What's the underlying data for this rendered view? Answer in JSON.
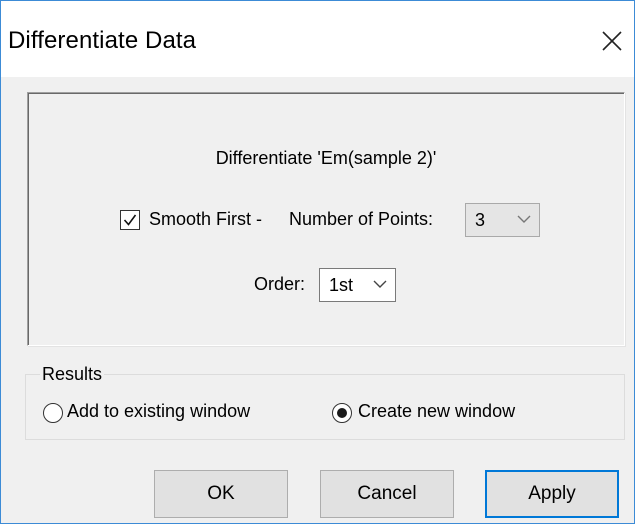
{
  "window": {
    "title": "Differentiate Data",
    "close_icon": "close-icon"
  },
  "main": {
    "description": "Differentiate 'Em(sample 2)'",
    "smooth_first": {
      "label": "Smooth First -",
      "checked": true
    },
    "number_of_points": {
      "label": "Number of Points:",
      "value": "3",
      "enabled": false
    },
    "order": {
      "label": "Order:",
      "value": "1st"
    }
  },
  "results": {
    "legend": "Results",
    "options": [
      {
        "label": "Add to existing window",
        "selected": false
      },
      {
        "label": "Create new window",
        "selected": true
      }
    ]
  },
  "buttons": {
    "ok": "OK",
    "cancel": "Cancel",
    "apply": "Apply"
  },
  "colors": {
    "accent": "#0078d7",
    "dialog_bg": "#f0f0f0",
    "disabled_combo_bg": "#e5e5e5"
  }
}
